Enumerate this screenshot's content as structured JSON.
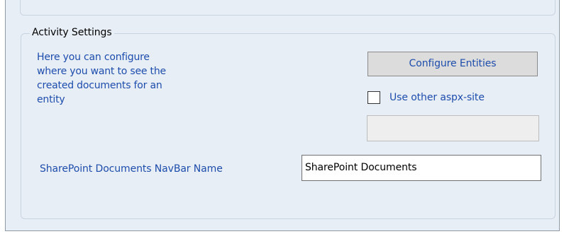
{
  "activity_settings": {
    "title": "Activity Settings",
    "description": "Here you can configure\nwhere you want to see the\ncreated documents for an\nentity",
    "configure_button_label": "Configure Entities",
    "checkbox": {
      "label": "Use other aspx-site",
      "checked": false
    },
    "aspx_site_value": "",
    "navbar_label": "SharePoint Documents NavBar Name",
    "navbar_value": "SharePoint Documents"
  },
  "colors": {
    "panel_background": "#e8eef6",
    "label_text": "#1d4dac",
    "button_background": "#dcdcdc"
  }
}
